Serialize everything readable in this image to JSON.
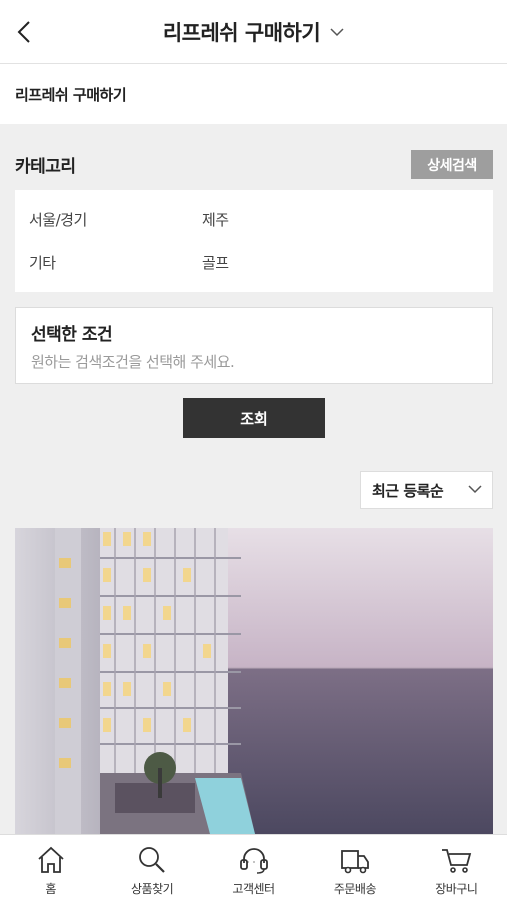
{
  "header": {
    "title": "리프레쉬 구매하기"
  },
  "subheader": {
    "label": "리프레쉬 구매하기"
  },
  "category": {
    "title": "카테고리",
    "detail_search_label": "상세검색",
    "items": [
      "서울/경기",
      "제주",
      "기타",
      "골프"
    ]
  },
  "conditions": {
    "title": "선택한 조건",
    "placeholder": "원하는 검색조건을 선택해 주세요."
  },
  "search_button_label": "조회",
  "sort": {
    "selected": "최근 등록순"
  },
  "bottom_nav": {
    "items": [
      {
        "label": "홈",
        "icon": "home-icon"
      },
      {
        "label": "상품찾기",
        "icon": "search-icon"
      },
      {
        "label": "고객센터",
        "icon": "headset-icon"
      },
      {
        "label": "주문배송",
        "icon": "delivery-truck-icon"
      },
      {
        "label": "장바구니",
        "icon": "cart-icon"
      }
    ]
  },
  "colors": {
    "detail_button": "#9e9e9e",
    "search_button": "#333333",
    "background": "#efefef"
  }
}
